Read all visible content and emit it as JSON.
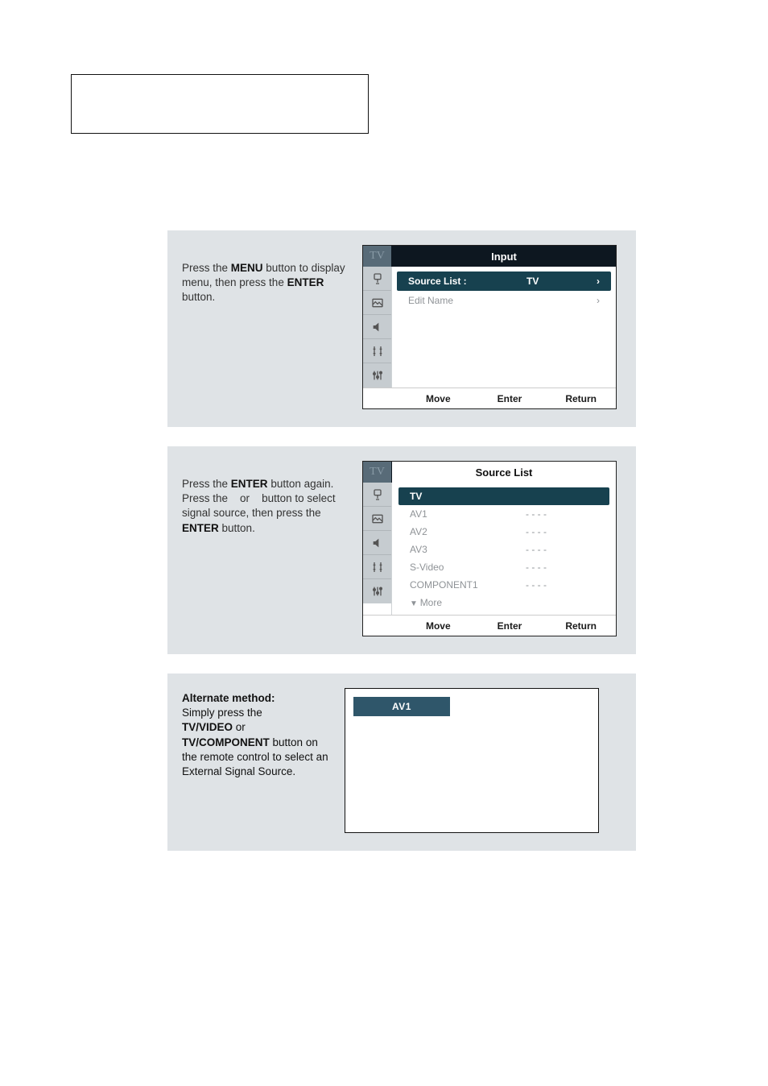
{
  "step1": {
    "instruction_prefix": "Press the ",
    "menu_word": "MENU",
    "instruction_mid": " button to display menu, then press the ",
    "enter_word": "ENTER",
    "instruction_suffix": " button.",
    "osd": {
      "tab_tv": "TV",
      "title": "Input",
      "rows": {
        "source_label": "Source List :",
        "source_value": "TV",
        "edit_label": "Edit Name"
      },
      "footer": {
        "a": "Move",
        "b": "Enter",
        "c": "Return"
      }
    }
  },
  "step2": {
    "line1_a": "Press the ",
    "line1_b": "ENTER",
    "line1_c": " button again.",
    "line2_a": "Press the ",
    "line2_b": "or",
    "line2_c": "button to select signal source, then press the ",
    "line2_d": "ENTER",
    "line2_e": " button.",
    "osd": {
      "tab_tv": "TV",
      "title": "Source List",
      "items": [
        {
          "name": "TV",
          "dots": ""
        },
        {
          "name": "AV1",
          "dots": "- - - -"
        },
        {
          "name": "AV2",
          "dots": "- - - -"
        },
        {
          "name": "AV3",
          "dots": "- - - -"
        },
        {
          "name": "S-Video",
          "dots": "- - - -"
        },
        {
          "name": "COMPONENT1",
          "dots": "- - - -"
        }
      ],
      "more": "More",
      "footer": {
        "a": "Move",
        "b": "Enter",
        "c": "Return"
      }
    }
  },
  "step3": {
    "heading": "Alternate method:",
    "line_a": "Simply press the ",
    "b1": "TV/VIDEO",
    "or": " or ",
    "b2": "TV/COMPONENT",
    "tail": " button on the remote control to select an External Signal Source.",
    "toast": "AV1"
  }
}
